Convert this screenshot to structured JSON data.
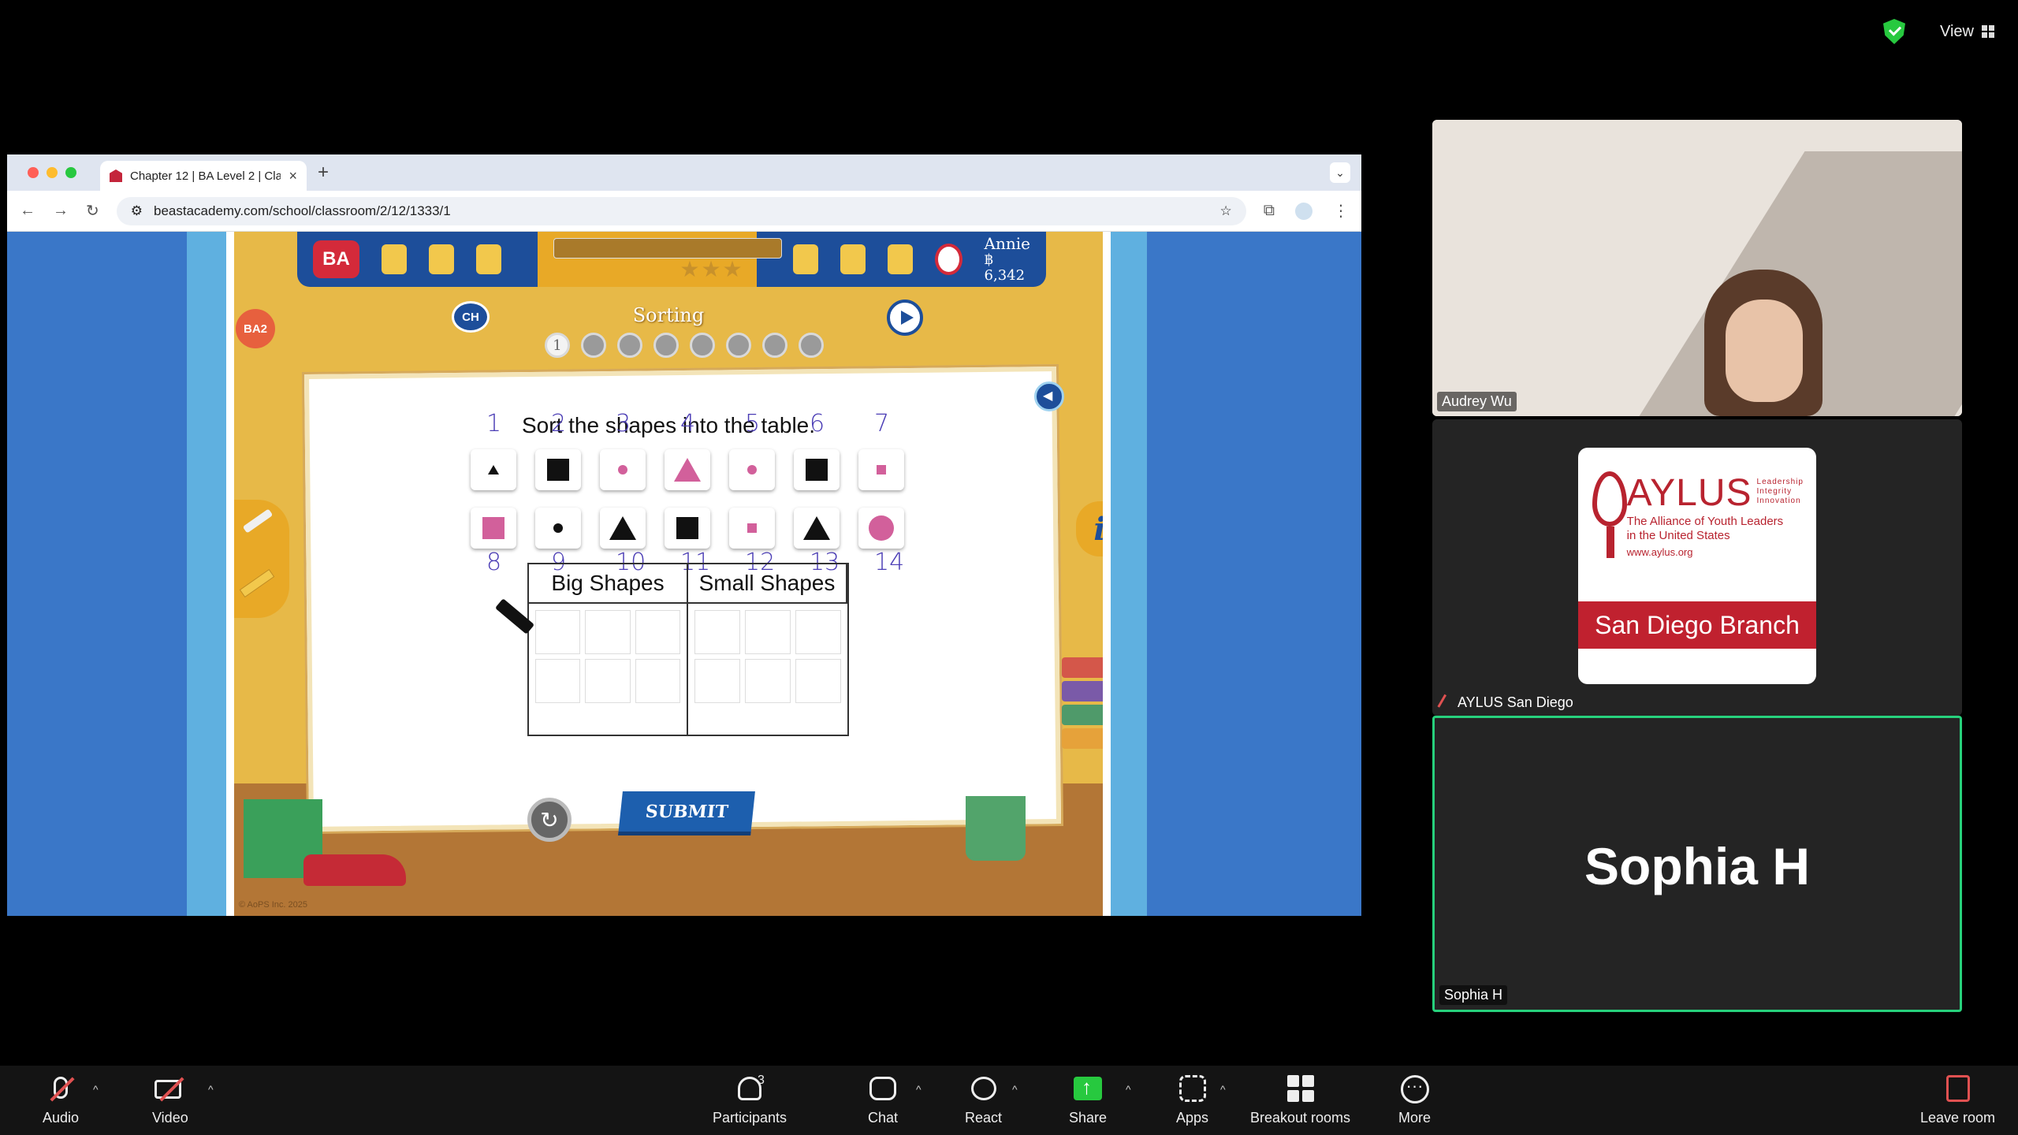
{
  "view": {
    "label": "View"
  },
  "browser": {
    "tab_title": "Chapter 12 | BA Level 2 | Clas",
    "url": "beastacademy.com/school/classroom/2/12/1333/1",
    "traffic_light_colors": [
      "#ff5f57",
      "#febc2e",
      "#28c840"
    ]
  },
  "game": {
    "logo": "BA",
    "level_tag": "BA2",
    "chapter_badge": "CH",
    "user_name": "Annie",
    "user_coins": "฿ 6,342",
    "stars": "★★★",
    "lesson_title": "Sorting",
    "steps": [
      "1",
      "",
      "",
      "",
      "",
      "",
      "",
      ""
    ],
    "prompt": "Sort the shapes into the table.",
    "hand_numbers_top": [
      "1",
      "2",
      "3",
      "4",
      "5",
      "6",
      "7"
    ],
    "hand_numbers_bottom": [
      "8",
      "9",
      "10",
      "11",
      "12",
      "13",
      "14"
    ],
    "table_headers": [
      "Big Shapes",
      "Small Shapes"
    ],
    "submit_label": "SUBMIT",
    "info_label": "i",
    "reset_label": "↻",
    "copyright": "© AoPS Inc. 2025",
    "colors": {
      "pink": "#d2609b",
      "black": "#111111",
      "nav": "#1d4e9a",
      "gold": "#e7b948"
    }
  },
  "participants": {
    "p1_name": "Audrey Wu",
    "p2_name": "AYLUS San Diego",
    "p3_name": "Sophia H",
    "p3_display": "Sophia H",
    "aylus_logo": {
      "big": "AYLUS",
      "tags": [
        "Leadership",
        "Integrity",
        "Innovation"
      ],
      "sub1": "The Alliance of Youth Leaders",
      "sub2": "in the United States",
      "url": "www.aylus.org",
      "band": "San Diego Branch"
    }
  },
  "meeting_bar": {
    "audio": "Audio",
    "video": "Video",
    "participants": "Participants",
    "participant_count": "3",
    "chat": "Chat",
    "react": "React",
    "share": "Share",
    "apps": "Apps",
    "breakout": "Breakout rooms",
    "more": "More",
    "leave": "Leave room"
  }
}
